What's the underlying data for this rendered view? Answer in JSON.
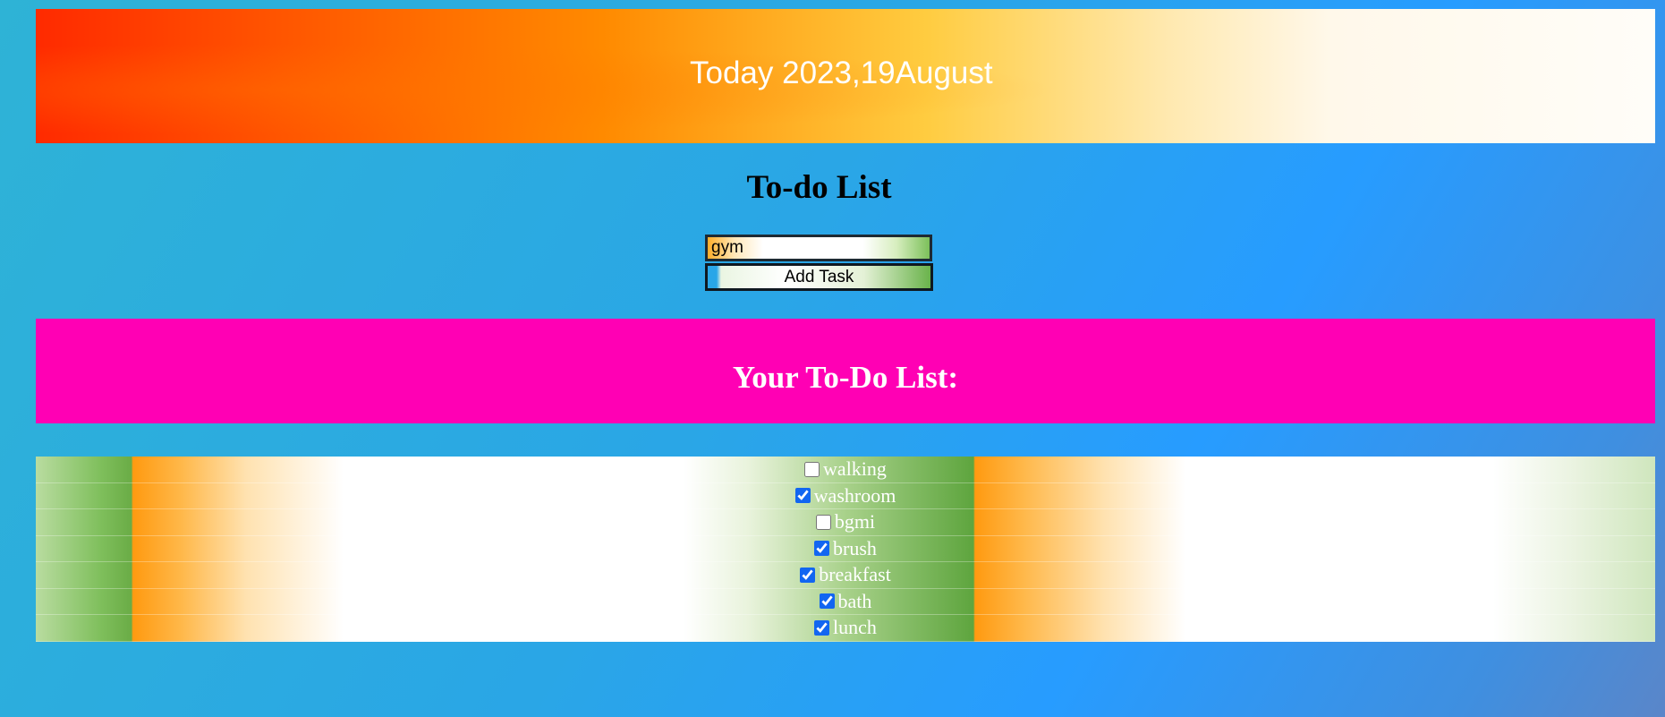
{
  "header": {
    "date_text": "Today 2023,19August"
  },
  "main": {
    "title": "To-do List",
    "task_input": {
      "value": "gym",
      "placeholder": ""
    },
    "add_button_label": "Add Task"
  },
  "list": {
    "heading": "Your To-Do List:",
    "items": [
      {
        "label": "walking",
        "checked": false
      },
      {
        "label": "washroom",
        "checked": true
      },
      {
        "label": "bgmi",
        "checked": false
      },
      {
        "label": "brush",
        "checked": true
      },
      {
        "label": "breakfast",
        "checked": true
      },
      {
        "label": "bath",
        "checked": true
      },
      {
        "label": "lunch",
        "checked": true
      }
    ]
  },
  "colors": {
    "list_banner": "#ff00b4",
    "checkbox_accent": "#1266f1"
  }
}
